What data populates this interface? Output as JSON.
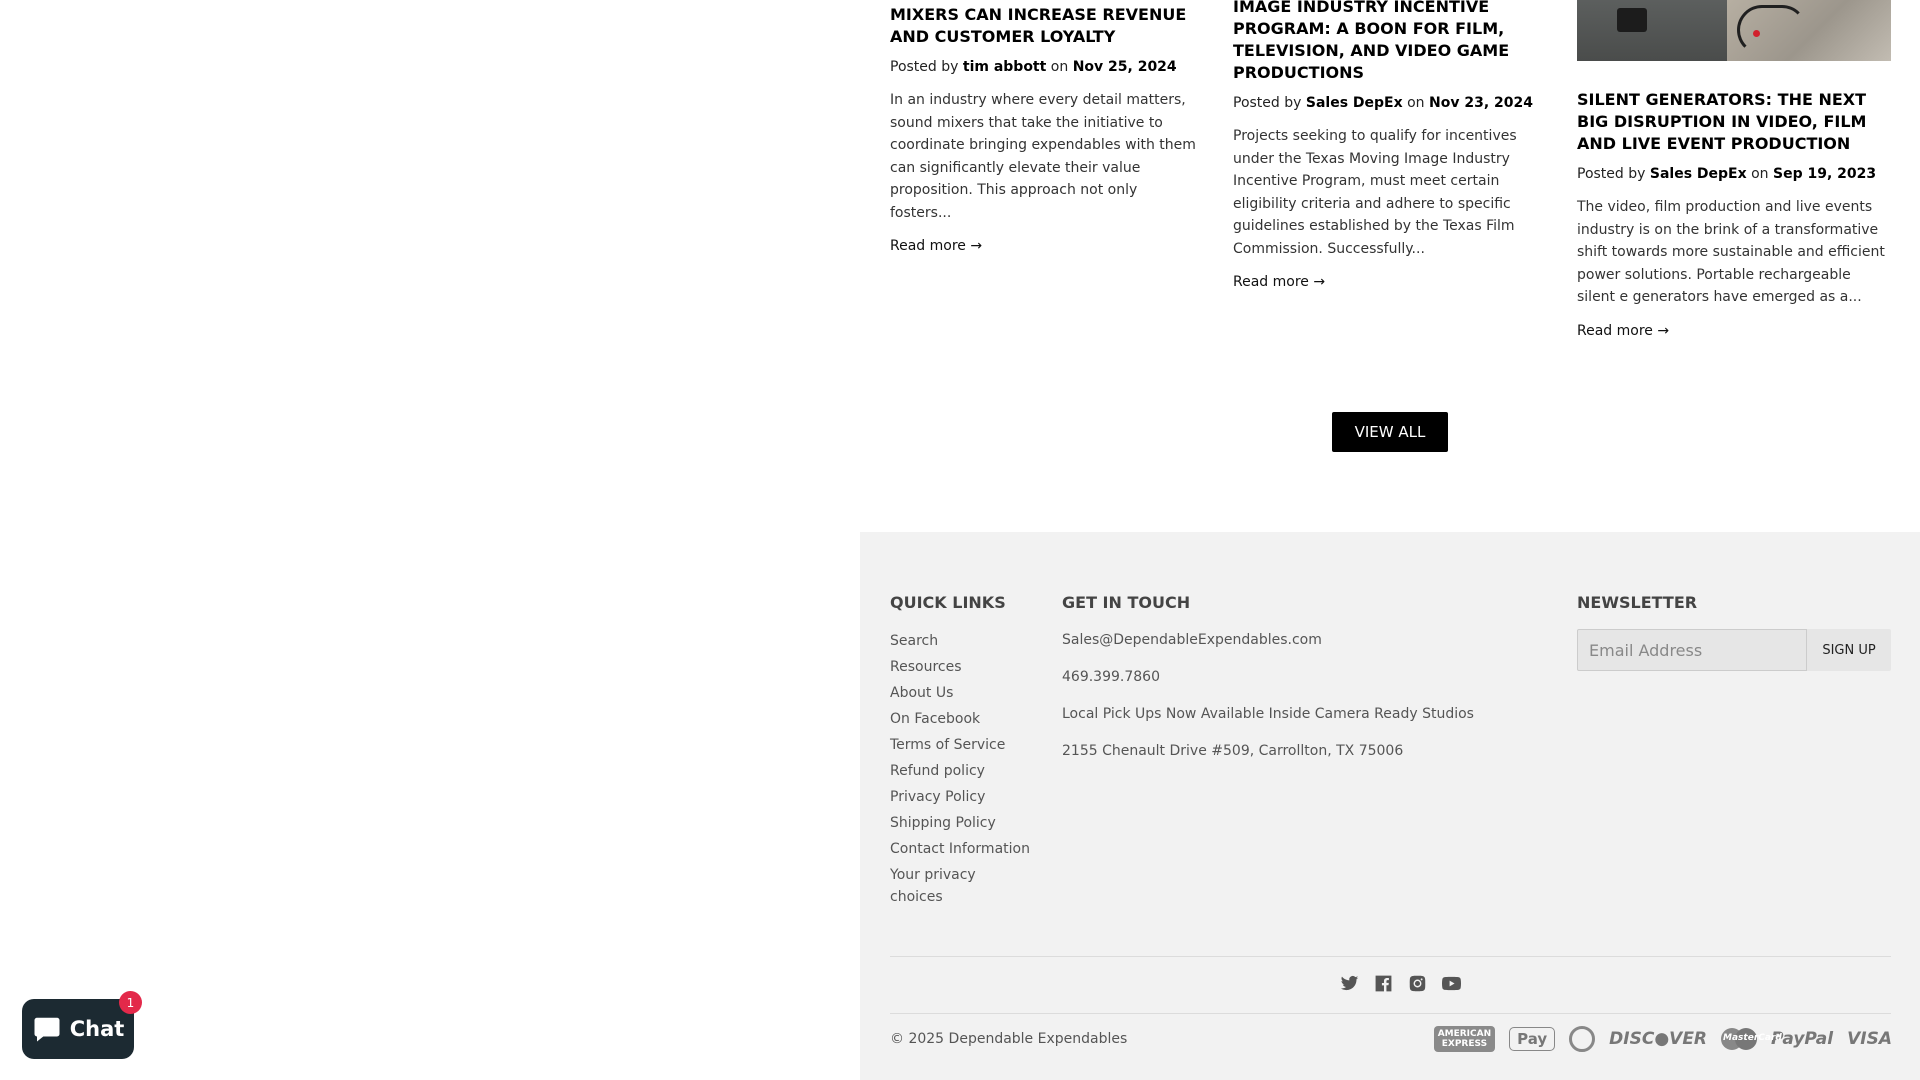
{
  "articles": [
    {
      "title": "MIXERS CAN INCREASE REVENUE AND CUSTOMER LOYALTY",
      "posted_by_label": "Posted by",
      "author": "tim abbott",
      "on_label": "on",
      "date": "Nov 25, 2024",
      "excerpt": "In an industry where every detail matters, sound mixers that take the initiative to coordinate bringing expendables with them can significantly elevate their value proposition. This approach not only fosters...",
      "read_more": "Read more →"
    },
    {
      "title": "IMAGE INDUSTRY INCENTIVE PROGRAM: A BOON FOR FILM, TELEVISION, AND VIDEO GAME PRODUCTIONS",
      "posted_by_label": "Posted by",
      "author": "Sales DepEx",
      "on_label": "on",
      "date": "Nov 23, 2024",
      "excerpt": "Projects seeking to qualify for incentives under the Texas Moving Image Industry Incentive Program, must meet certain eligibility criteria and adhere to specific guidelines established by the Texas Film Commission. Successfully...",
      "read_more": "Read more →"
    },
    {
      "title": "SILENT GENERATORS: THE NEXT BIG DISRUPTION IN VIDEO, FILM AND LIVE EVENT PRODUCTION",
      "posted_by_label": "Posted by",
      "author": "Sales DepEx",
      "on_label": "on",
      "date": "Sep 19, 2023",
      "excerpt": "The video, film production and live events industry is on the brink of a transformative shift towards more sustainable and efficient power solutions. Portable rechargeable silent e generators have emerged as a...",
      "read_more": "Read more →"
    }
  ],
  "view_all_label": "VIEW ALL",
  "footer": {
    "quick_links_title": "QUICK LINKS",
    "quick_links": [
      "Search",
      "Resources",
      "About Us",
      "On Facebook",
      "Terms of Service",
      "Refund policy",
      "Privacy Policy",
      "Shipping Policy",
      "Contact Information",
      "Your privacy choices"
    ],
    "get_in_touch_title": "GET IN TOUCH",
    "email": "Sales@DependableExpendables.com",
    "phone": "469.399.7860",
    "pickup_note": "Local Pick Ups Now Available Inside Camera Ready Studios",
    "address": "2155 Chenault Drive #509, Carrollton, TX 75006",
    "newsletter_title": "NEWSLETTER",
    "newsletter_placeholder": "Email Address",
    "signup_label": "SIGN UP",
    "social_icons": [
      "twitter-icon",
      "facebook-icon",
      "instagram-icon",
      "youtube-icon"
    ],
    "copyright_prefix": "© 2025",
    "company": "Dependable Expendables",
    "payments": [
      "American Express",
      "Apple Pay",
      "Diners Club",
      "Discover",
      "Master",
      "PayPal",
      "Visa"
    ]
  },
  "chat": {
    "label": "Chat",
    "badge": "1"
  },
  "colors": {
    "footer_bg": "#f2f2f2",
    "button_bg": "#000000",
    "chat_bg": "#1c2a32",
    "badge": "#e3294a"
  }
}
